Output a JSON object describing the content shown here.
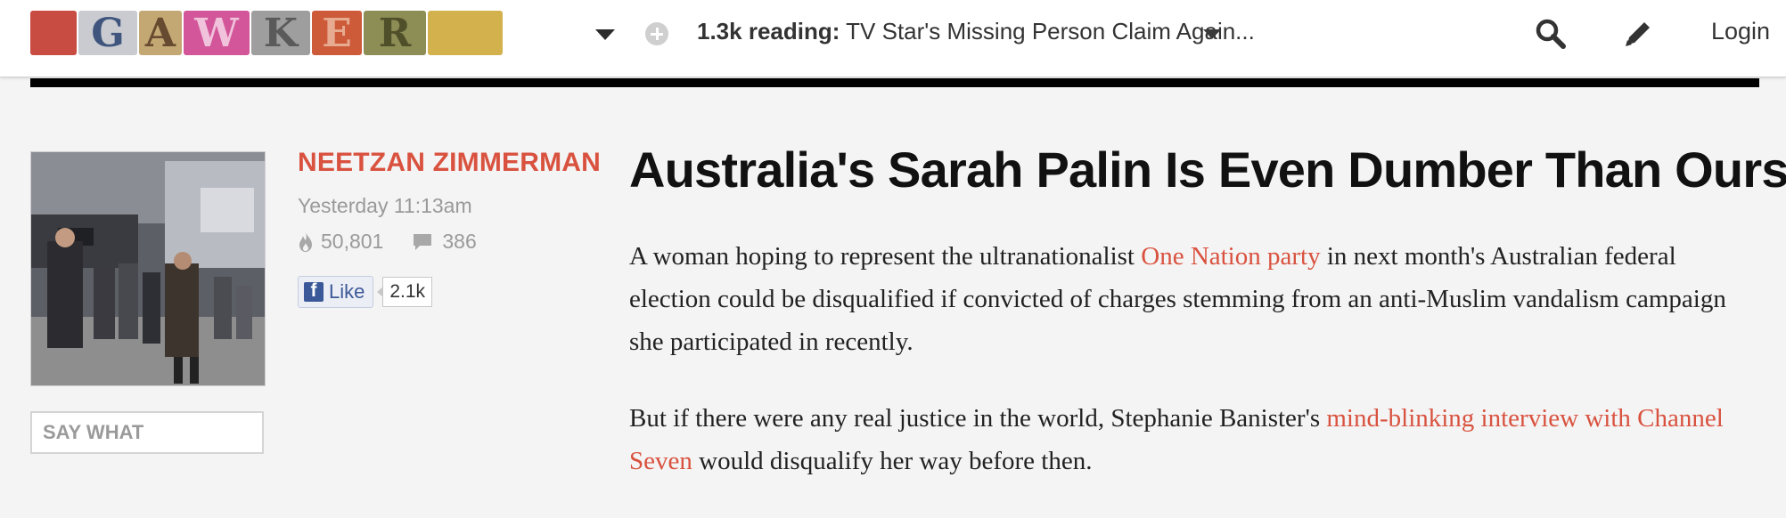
{
  "header": {
    "logo_letters": [
      "",
      "G",
      "A",
      "W",
      "K",
      "E",
      "R",
      ""
    ],
    "reading_count": "1.3k reading:",
    "reading_title": "TV Star's Missing Person Claim Again...",
    "login_label": "Login",
    "icons": [
      "chevron-down-icon",
      "plus-circle-icon",
      "search-icon",
      "pencil-icon"
    ]
  },
  "author": {
    "name": "NEETZAN ZIMMERMAN",
    "timestamp": "Yesterday 11:13am",
    "views": "50,801",
    "comments": "386",
    "like_label": "Like",
    "like_count": "2.1k"
  },
  "comment_box": {
    "placeholder": "SAY WHAT"
  },
  "article": {
    "headline": "Australia's Sarah Palin Is Even Dumber Than Ours",
    "p1_before": "A woman hoping to represent the ultranationalist ",
    "p1_link": "One Nation party",
    "p1_after": " in next month's Australian federal election could be disqualified if convicted of charges stemming from an anti-Muslim vandalism campaign she participated in recently.",
    "p2_before": "But if there were any real justice in the world, Stephanie Banister's ",
    "p2_link": "mind-blinking interview with Channel Seven",
    "p2_after": " would disqualify her way before then."
  },
  "colors": {
    "accent": "#d9523f",
    "rule": "#000000",
    "facebook": "#3b5998"
  }
}
